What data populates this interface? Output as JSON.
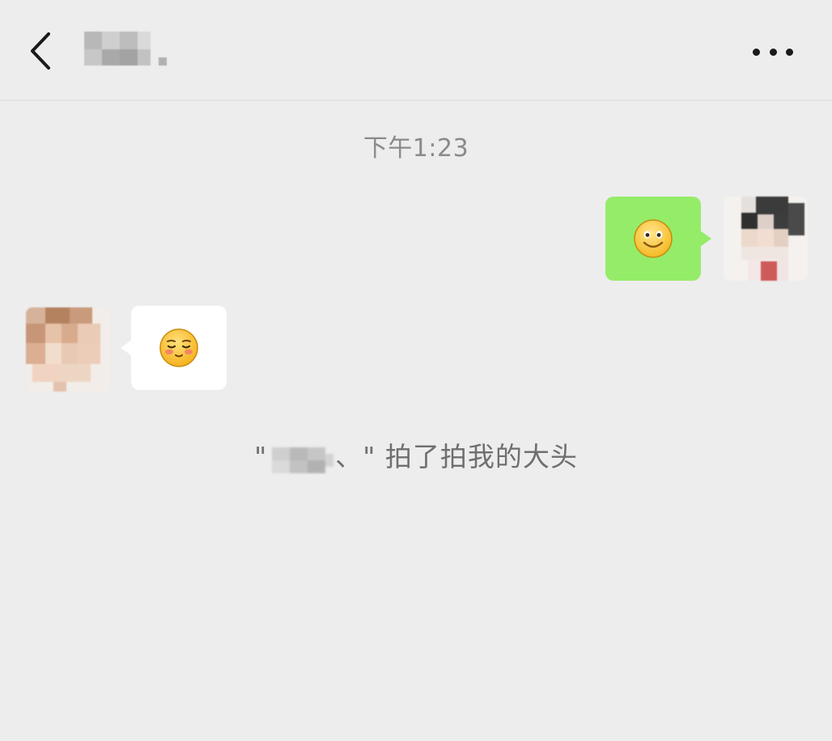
{
  "header": {
    "contact_name": "",
    "back_icon": "chevron-left-icon",
    "more_icon": "more-dots-icon"
  },
  "timestamp": "下午1:23",
  "messages": [
    {
      "direction": "sent",
      "content_type": "emoji",
      "emoji": "smile-face",
      "bubble_color": "#95ec69"
    },
    {
      "direction": "received",
      "content_type": "emoji",
      "emoji": "pleading-shy-face",
      "bubble_color": "#ffffff"
    }
  ],
  "system_message": {
    "open_quote": "\"",
    "name_suffix": "、\"",
    "action_text": " 拍了拍我的大头"
  },
  "colors": {
    "background": "#ededed",
    "sent_bubble": "#95ec69",
    "received_bubble": "#ffffff",
    "timestamp_text": "#8a8a8a",
    "system_text": "#6f6f6f"
  }
}
